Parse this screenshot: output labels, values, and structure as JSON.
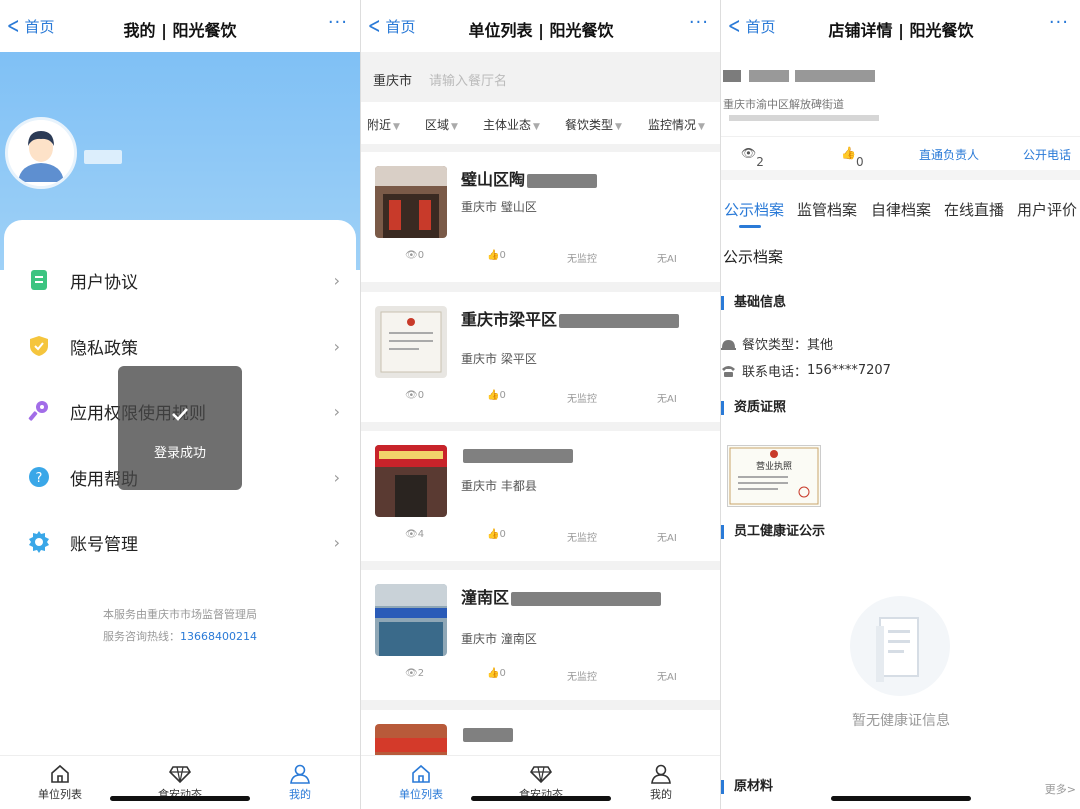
{
  "panel1": {
    "header": {
      "back": "首页",
      "title": "我的 | 阳光餐饮",
      "more": "···"
    },
    "menu": [
      {
        "label": "用户协议",
        "icon": "document-icon",
        "color": "#3cc481"
      },
      {
        "label": "隐私政策",
        "icon": "shield-icon",
        "color": "#f5c53d"
      },
      {
        "label": "应用权限使用规则",
        "icon": "key-icon",
        "color": "#a26de8"
      },
      {
        "label": "使用帮助",
        "icon": "help-icon",
        "color": "#3aa7e8"
      },
      {
        "label": "账号管理",
        "icon": "gear-icon",
        "color": "#3aa7e8"
      }
    ],
    "footer_line1": "本服务由重庆市市场监督管理局",
    "footer_line2_prefix": "服务咨询热线：",
    "hotline": "13668400214",
    "toast": "登录成功"
  },
  "panel2": {
    "header": {
      "back": "首页",
      "title": "单位列表 | 阳光餐饮",
      "more": "···"
    },
    "search": {
      "city": "重庆市",
      "placeholder": "请输入餐厅名"
    },
    "filters": [
      "附近",
      "区域",
      "主体业态",
      "餐饮类型",
      "监控情况"
    ],
    "shops": [
      {
        "name": "璧山区陶",
        "location": "重庆市  璧山区",
        "views": "0",
        "likes": "0",
        "monitor": "无监控",
        "ai": "无AI"
      },
      {
        "name": "重庆市梁平区",
        "location": "重庆市  梁平区",
        "views": "0",
        "likes": "0",
        "monitor": "无监控",
        "ai": "无AI"
      },
      {
        "name": "",
        "location": "重庆市  丰都县",
        "views": "4",
        "likes": "0",
        "monitor": "无监控",
        "ai": "无AI"
      },
      {
        "name": "潼南区",
        "location": "重庆市  潼南区",
        "views": "2",
        "likes": "0",
        "monitor": "无监控",
        "ai": "无AI"
      }
    ]
  },
  "panel3": {
    "header": {
      "back": "首页",
      "title": "店铺详情 | 阳光餐饮",
      "more": "···"
    },
    "address": "重庆市渝中区解放碑街道",
    "views": "2",
    "likes": "0",
    "contact_manager": "直通负责人",
    "public_phone": "公开电话",
    "tabs": [
      "公示档案",
      "监管档案",
      "自律档案",
      "在线直播",
      "用户评价"
    ],
    "section_title": "公示档案",
    "basic_info": "基础信息",
    "food_type_label": "餐饮类型：",
    "food_type": "其他",
    "phone_label": "联系电话：",
    "phone": "156****7207",
    "qualification": "资质证照",
    "license_text": "营业执照",
    "health_cert": "员工健康证公示",
    "empty_text": "暂无健康证信息",
    "materials": "原材料",
    "more": "更多>"
  },
  "tabbar": {
    "list": "单位列表",
    "news": "食安动态",
    "mine": "我的"
  },
  "colors": {
    "accent": "#2a7ad7",
    "sky": "#8ecaf6"
  }
}
